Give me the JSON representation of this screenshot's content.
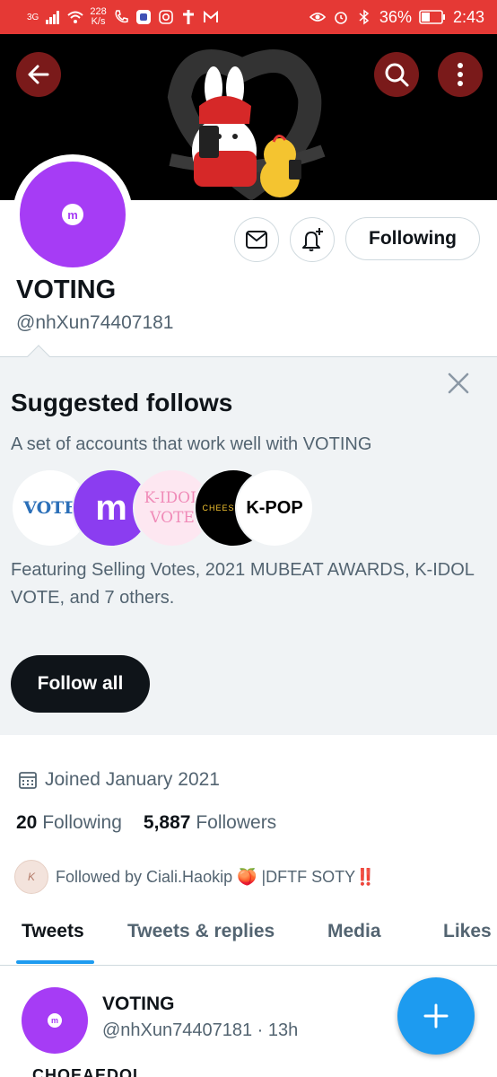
{
  "status_bar": {
    "signal_type": "3G",
    "net_speed_value": "228",
    "net_speed_unit": "K/s",
    "battery": "36%",
    "time": "2:43"
  },
  "profile": {
    "name": "VOTING",
    "handle": "@nhXun74407181",
    "following_button": "Following",
    "avatar_logo": "m",
    "joined": "Joined January 2021",
    "following_count": "20",
    "following_label": "Following",
    "followers_count": "5,887",
    "followers_label": "Followers",
    "followed_by": "Followed by Ciali.Haokip 🍑 |DFTF SOTY‼️"
  },
  "suggested": {
    "title": "Suggested follows",
    "subtitle": "A set of accounts that work well with VOTING",
    "avatars": [
      {
        "text": "VOTE",
        "bg": "#ffffff",
        "fg": "#2b6fb8"
      },
      {
        "text": "m",
        "bg": "#8b3df0",
        "fg": "#ffffff"
      },
      {
        "text": "K-IDOL VOTE",
        "bg": "#fde7f1",
        "fg": "#f08bb8"
      },
      {
        "text": "CHEESEMISS",
        "bg": "#000000",
        "fg": "#f4c430"
      },
      {
        "text": "K-POP",
        "bg": "#ffffff",
        "fg": "#000000"
      }
    ],
    "featuring": "Featuring Selling Votes, 2021 MUBEAT AWARDS, K-IDOL VOTE, and 7 others.",
    "follow_all": "Follow all"
  },
  "tabs": [
    {
      "label": "Tweets",
      "active": true
    },
    {
      "label": "Tweets & replies",
      "active": false
    },
    {
      "label": "Media",
      "active": false
    },
    {
      "label": "Likes",
      "active": false
    }
  ],
  "tweet": {
    "name": "VOTING",
    "meta": "@nhXun74407181 · 13h",
    "peek": "CHOEAEDOL"
  },
  "colors": {
    "status_bar": "#e53935",
    "accent": "#1d9bf0",
    "avatar": "#a63cf5"
  },
  "icons": [
    "back-arrow-icon",
    "search-icon",
    "more-vertical-icon",
    "mail-icon",
    "bell-plus-icon",
    "close-icon",
    "calendar-icon",
    "plus-icon"
  ]
}
